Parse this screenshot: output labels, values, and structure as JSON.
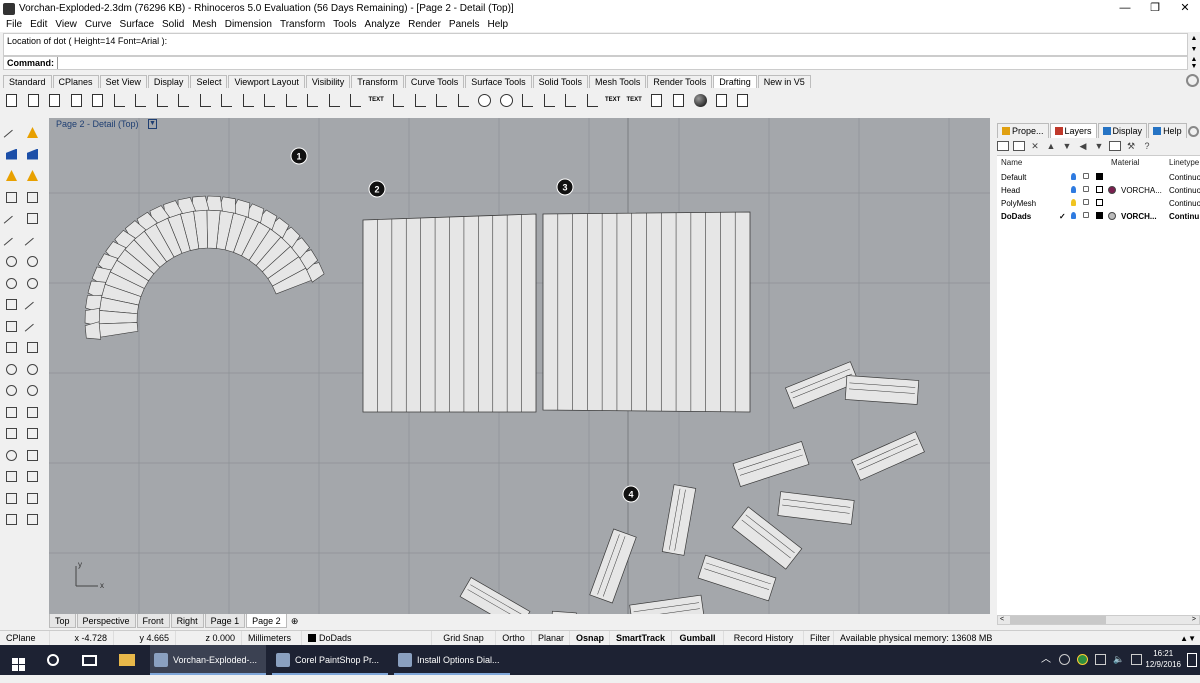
{
  "window": {
    "title": "Vorchan-Exploded-2.3dm (76296 KB) - Rhinoceros 5.0 Evaluation (56 Days Remaining) - [Page 2 - Detail (Top)]",
    "controls": [
      "—",
      "❐",
      "✕"
    ]
  },
  "menu": [
    "File",
    "Edit",
    "View",
    "Curve",
    "Surface",
    "Solid",
    "Mesh",
    "Dimension",
    "Transform",
    "Tools",
    "Analyze",
    "Render",
    "Panels",
    "Help"
  ],
  "command": {
    "history": "Location of dot ( Height=14  Font=Arial ):",
    "label": "Command:",
    "value": ""
  },
  "toolbar_tabs": [
    "Standard",
    "CPlanes",
    "Set View",
    "Display",
    "Select",
    "Viewport Layout",
    "Visibility",
    "Transform",
    "Curve Tools",
    "Surface Tools",
    "Solid Tools",
    "Mesh Tools",
    "Render Tools",
    "Drafting",
    "New in V5"
  ],
  "toolbar_active_tab": "Drafting",
  "toolbar_icons": [
    "page-icon",
    "page-icon",
    "page-icon",
    "page-icon",
    "page-icon",
    "dim-icon",
    "dim-icon",
    "dim-icon",
    "dim-icon",
    "dim-icon",
    "dim-icon",
    "dim-icon",
    "dim-icon",
    "dim-icon",
    "dim-icon",
    "dim-icon",
    "dim-icon",
    "text-icon",
    "dim-icon",
    "dim-icon",
    "dim-icon",
    "dim-icon",
    "hatch-icon",
    "hatch-icon",
    "dim-icon",
    "dim-icon",
    "dim-icon",
    "dim-icon",
    "text-icon",
    "text-icon",
    "box-icon",
    "box-icon",
    "render-ball-icon",
    "print-icon",
    "print-icon"
  ],
  "toolbar_text_icons": {
    "text1": "TEXT",
    "text2": "TEXT",
    "text3": "TEXT",
    "text4": "TEXT"
  },
  "viewport": {
    "title": "Page 2 - Detail (Top)",
    "axis_y": "y",
    "axis_x": "x",
    "dots": [
      "1",
      "2",
      "3",
      "4"
    ]
  },
  "viewport_tabs": [
    "Top",
    "Perspective",
    "Front",
    "Right",
    "Page 1",
    "Page 2"
  ],
  "viewport_tab_active": "Page 2",
  "viewport_tab_add": "⊕",
  "panel_tabs": [
    "Prope...",
    "Layers",
    "Display",
    "Help"
  ],
  "panel_tab_active": "Layers",
  "layers": {
    "headers": {
      "name": "Name",
      "material": "Material",
      "linetype": "Linetype"
    },
    "rows": [
      {
        "name": "Default",
        "current": "",
        "material": "",
        "linetype": "Continuo",
        "color": "#000000",
        "bulb": "#2f7be0",
        "bold": false
      },
      {
        "name": "Head",
        "current": "",
        "material": "VORCHA...",
        "linetype": "Continuo",
        "color": "#ffffff",
        "bulb": "#2f7be0",
        "bold": false,
        "matcolor": "#7a1f4f"
      },
      {
        "name": "PolyMesh",
        "current": "",
        "material": "",
        "linetype": "Continuo",
        "color": "#ffffff",
        "bulb": "#f0c420",
        "bold": false
      },
      {
        "name": "DoDads",
        "current": "✓",
        "material": "VORCH...",
        "linetype": "Continu",
        "color": "#000000",
        "bulb": "#2f7be0",
        "bold": true,
        "matcolor": "#bbbbbb"
      }
    ],
    "scroll_left": "<",
    "scroll_right": ">"
  },
  "status": {
    "cplane": "CPlane",
    "x": "x -4.728",
    "y": "y 4.665",
    "z": "z 0.000",
    "units": "Millimeters",
    "layer": "DoDads",
    "items": [
      "Grid Snap",
      "Ortho",
      "Planar",
      "Osnap",
      "SmartTrack",
      "Gumball",
      "Record History",
      "Filter"
    ],
    "bold_items": [
      "Osnap",
      "SmartTrack",
      "Gumball"
    ],
    "memory": "Available physical memory: 13608 MB"
  },
  "taskbar": {
    "apps": [
      "Vorchan-Exploded-...",
      "Corel PaintShop Pr...",
      "Install Options Dial..."
    ],
    "active_app": "Vorchan-Exploded-...",
    "time": "16:21",
    "date": "12/9/2016"
  },
  "colors": {
    "viewport_bg": "#a4a7ab",
    "grid": "#8e9196",
    "mesh_fill": "#e6e6e6",
    "taskbar": "#1d2233"
  }
}
